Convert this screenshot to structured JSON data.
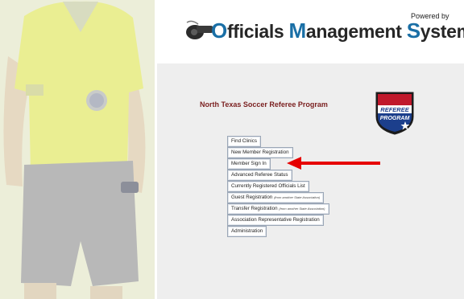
{
  "header": {
    "powered_by": "Powered by",
    "logo_words": [
      {
        "cap": "O",
        "rest": "fficials "
      },
      {
        "cap": "M",
        "rest": "anagement "
      },
      {
        "cap": "S",
        "rest": "ystems"
      }
    ]
  },
  "program": {
    "title": "North Texas Soccer Referee Program",
    "badge_line1": "REFEREE",
    "badge_line2": "PROGRAM"
  },
  "menu": [
    {
      "label": "Find Clinics",
      "sub": ""
    },
    {
      "label": "New Member Registration",
      "sub": ""
    },
    {
      "label": "Member Sign In",
      "sub": ""
    },
    {
      "label": "Advanced Referee Status",
      "sub": ""
    },
    {
      "label": "Currently Registered Officials List",
      "sub": ""
    },
    {
      "label": "Guest Registration",
      "sub": "(from another State Association)"
    },
    {
      "label": "Transfer Registration",
      "sub": "(from another State Association)"
    },
    {
      "label": "Association Representative Registration",
      "sub": ""
    },
    {
      "label": "Administration",
      "sub": ""
    }
  ],
  "colors": {
    "accent_blue": "#1a6fa6",
    "program_title": "#7a1f1f",
    "arrow_red": "#e60000",
    "content_bg": "#eeeeee"
  }
}
